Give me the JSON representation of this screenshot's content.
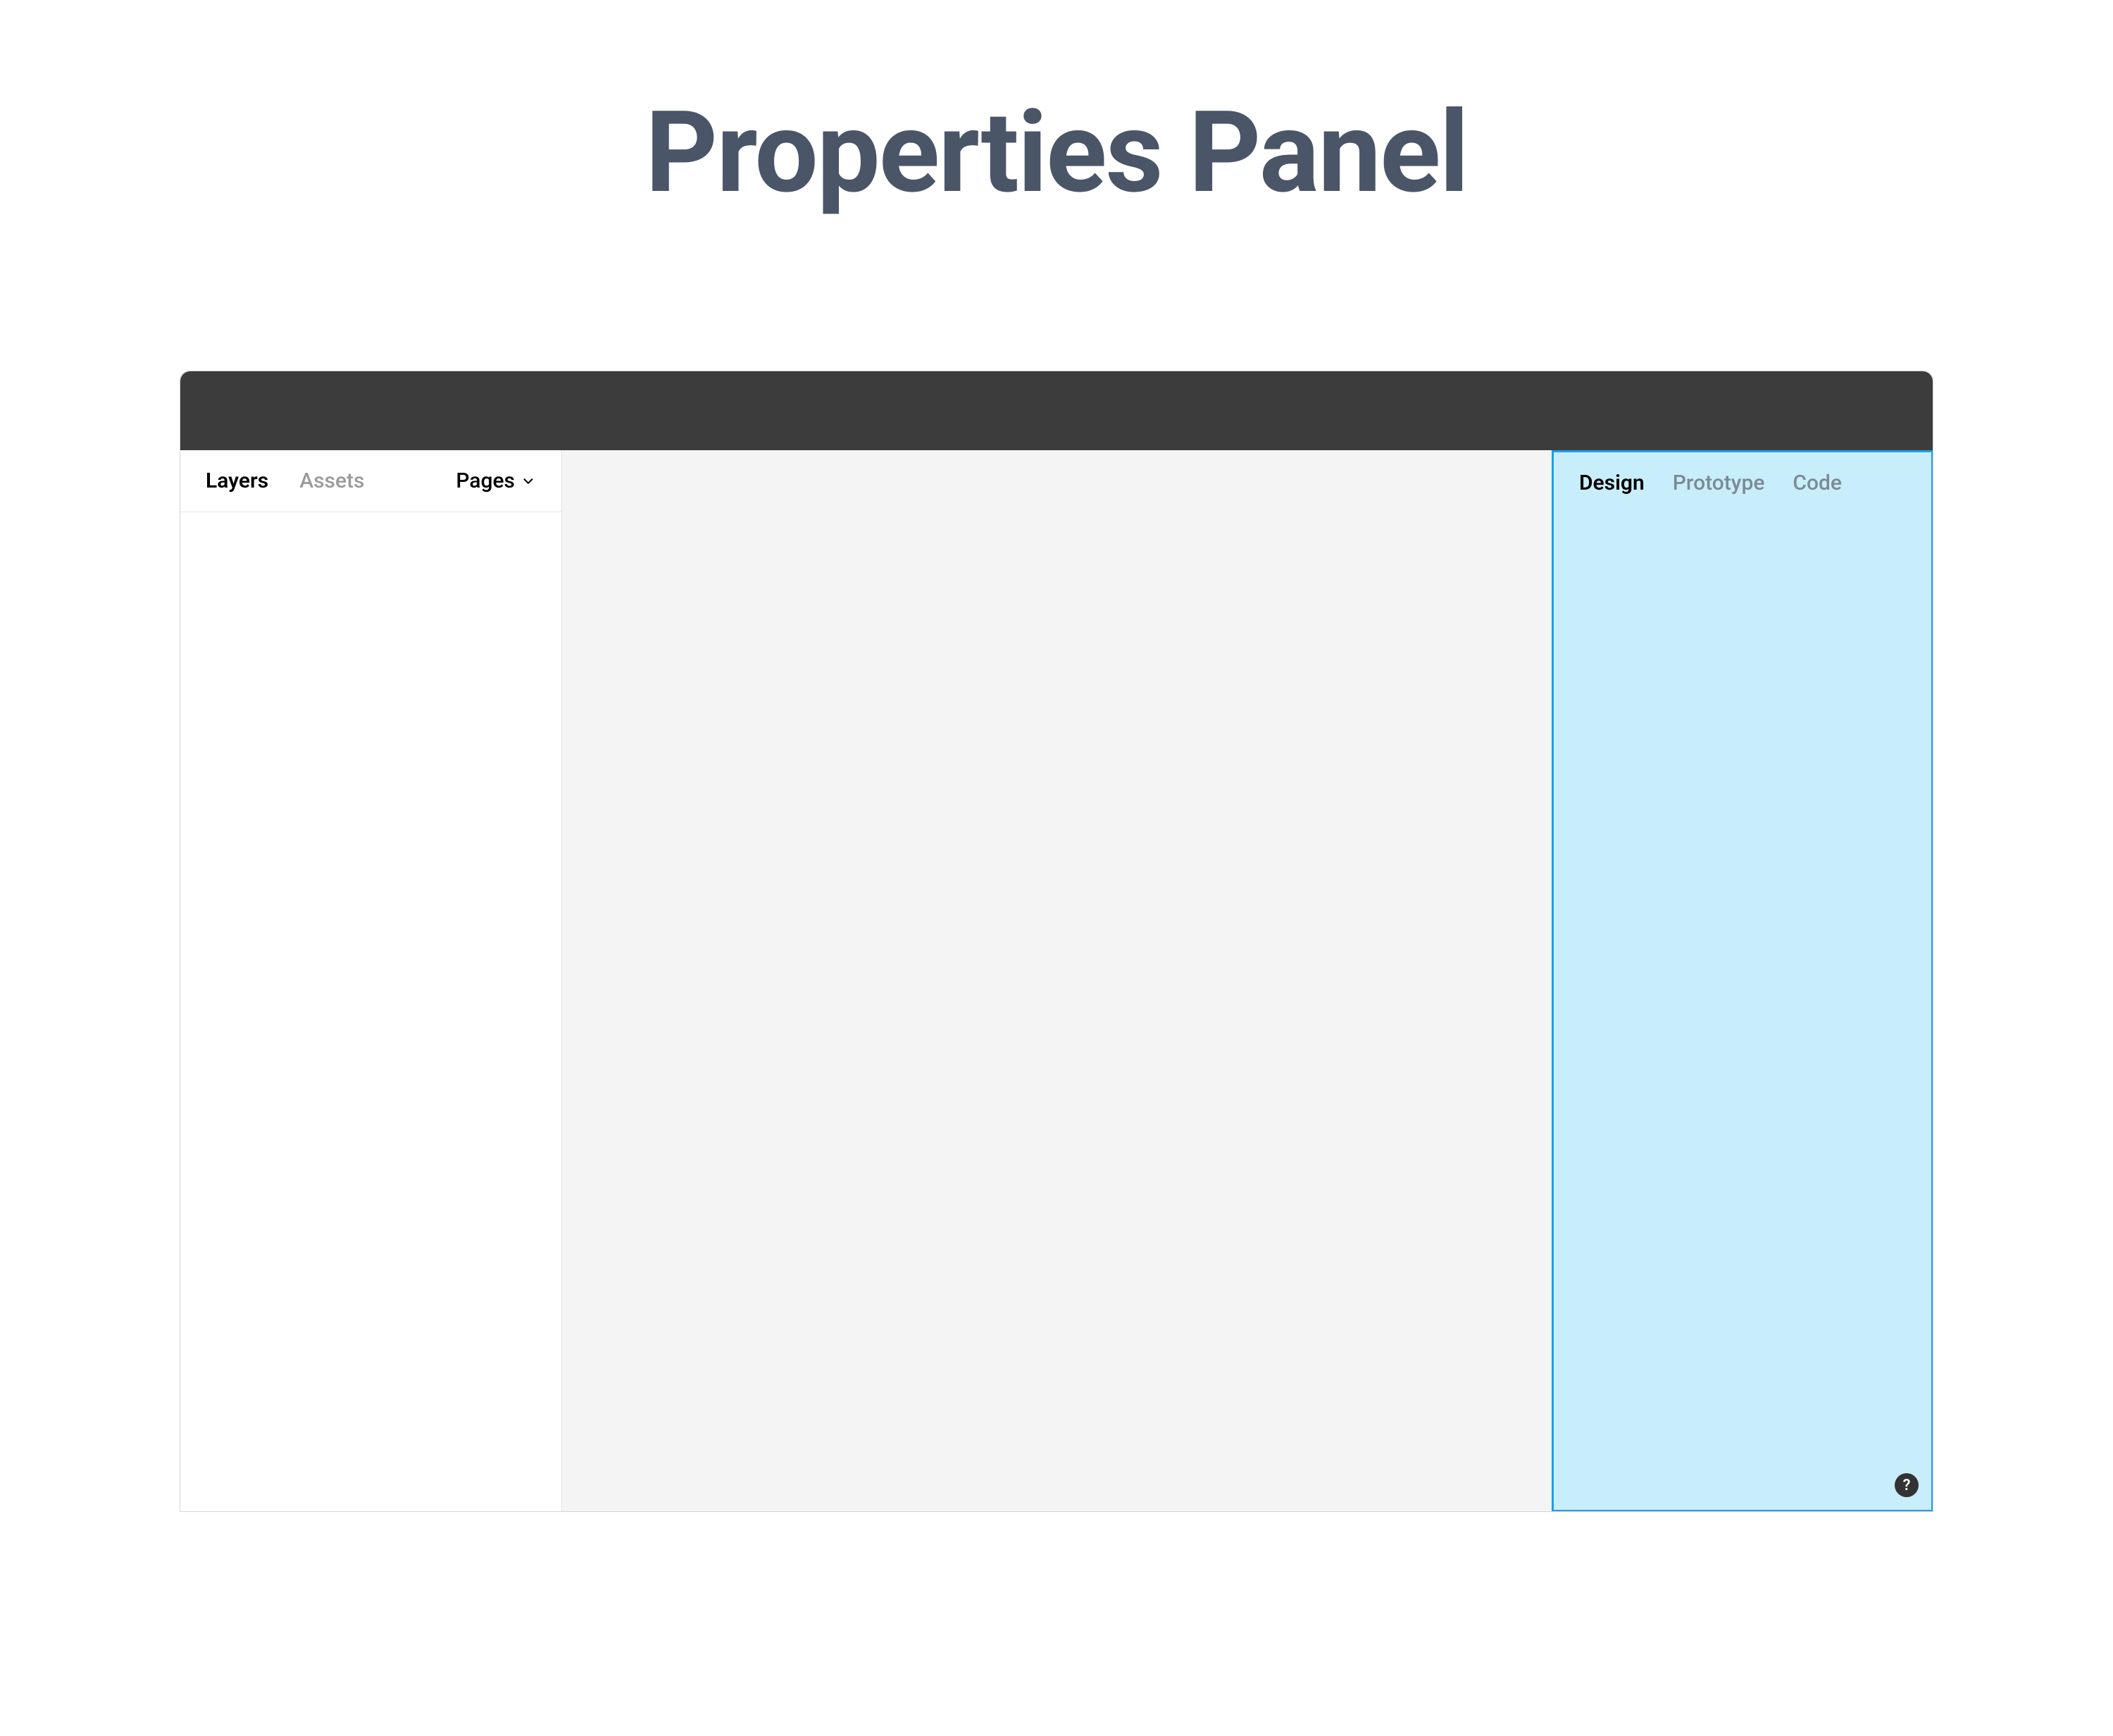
{
  "heading": "Properties Panel",
  "leftPanel": {
    "tabs": {
      "layers": "Layers",
      "assets": "Assets"
    },
    "pages": {
      "label": "Pages"
    }
  },
  "rightPanel": {
    "tabs": {
      "design": "Design",
      "prototype": "Prototype",
      "code": "Code"
    },
    "helpLabel": "?"
  }
}
